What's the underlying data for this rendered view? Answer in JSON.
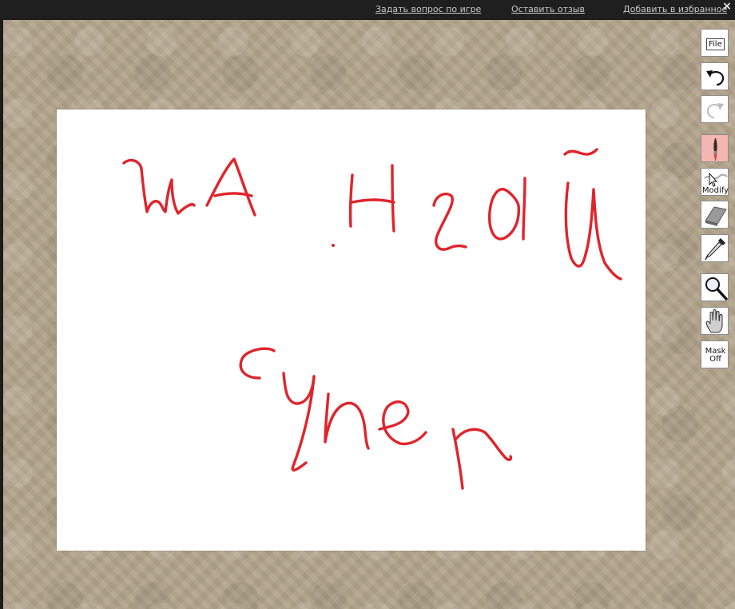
{
  "header": {
    "links": [
      {
        "label": "Задать вопрос по игре"
      },
      {
        "label": "Оставить отзыв"
      },
      {
        "label": "Добавить в избранное"
      }
    ],
    "close_label": "×"
  },
  "toolbar": {
    "file_label": "File",
    "modify_label": "Modify",
    "mask_label_1": "Mask",
    "mask_label_2": "Off",
    "tools": [
      {
        "name": "file",
        "icon": "file-icon"
      },
      {
        "name": "undo",
        "icon": "undo-icon"
      },
      {
        "name": "redo",
        "icon": "redo-icon",
        "disabled": true
      },
      {
        "name": "brush",
        "icon": "brush-icon",
        "active": true
      },
      {
        "name": "modify",
        "icon": "modify-icon"
      },
      {
        "name": "eraser",
        "icon": "eraser-icon"
      },
      {
        "name": "eyedropper",
        "icon": "eyedropper-icon"
      },
      {
        "name": "zoom",
        "icon": "magnifier-icon"
      },
      {
        "name": "pan",
        "icon": "hand-icon"
      },
      {
        "name": "mask",
        "icon": "mask-icon"
      }
    ]
  },
  "canvas": {
    "background_color": "#ffffff",
    "stroke_color": "#e0242b",
    "drawings": [
      {
        "name": "handwritten-word-top",
        "text": "шанхай"
      },
      {
        "name": "handwritten-word-bottom",
        "text": "супер"
      }
    ]
  },
  "colors": {
    "workspace": "#b3a48b",
    "topbar": "#1f1f1f",
    "active_tool": "#f4b6b2"
  }
}
